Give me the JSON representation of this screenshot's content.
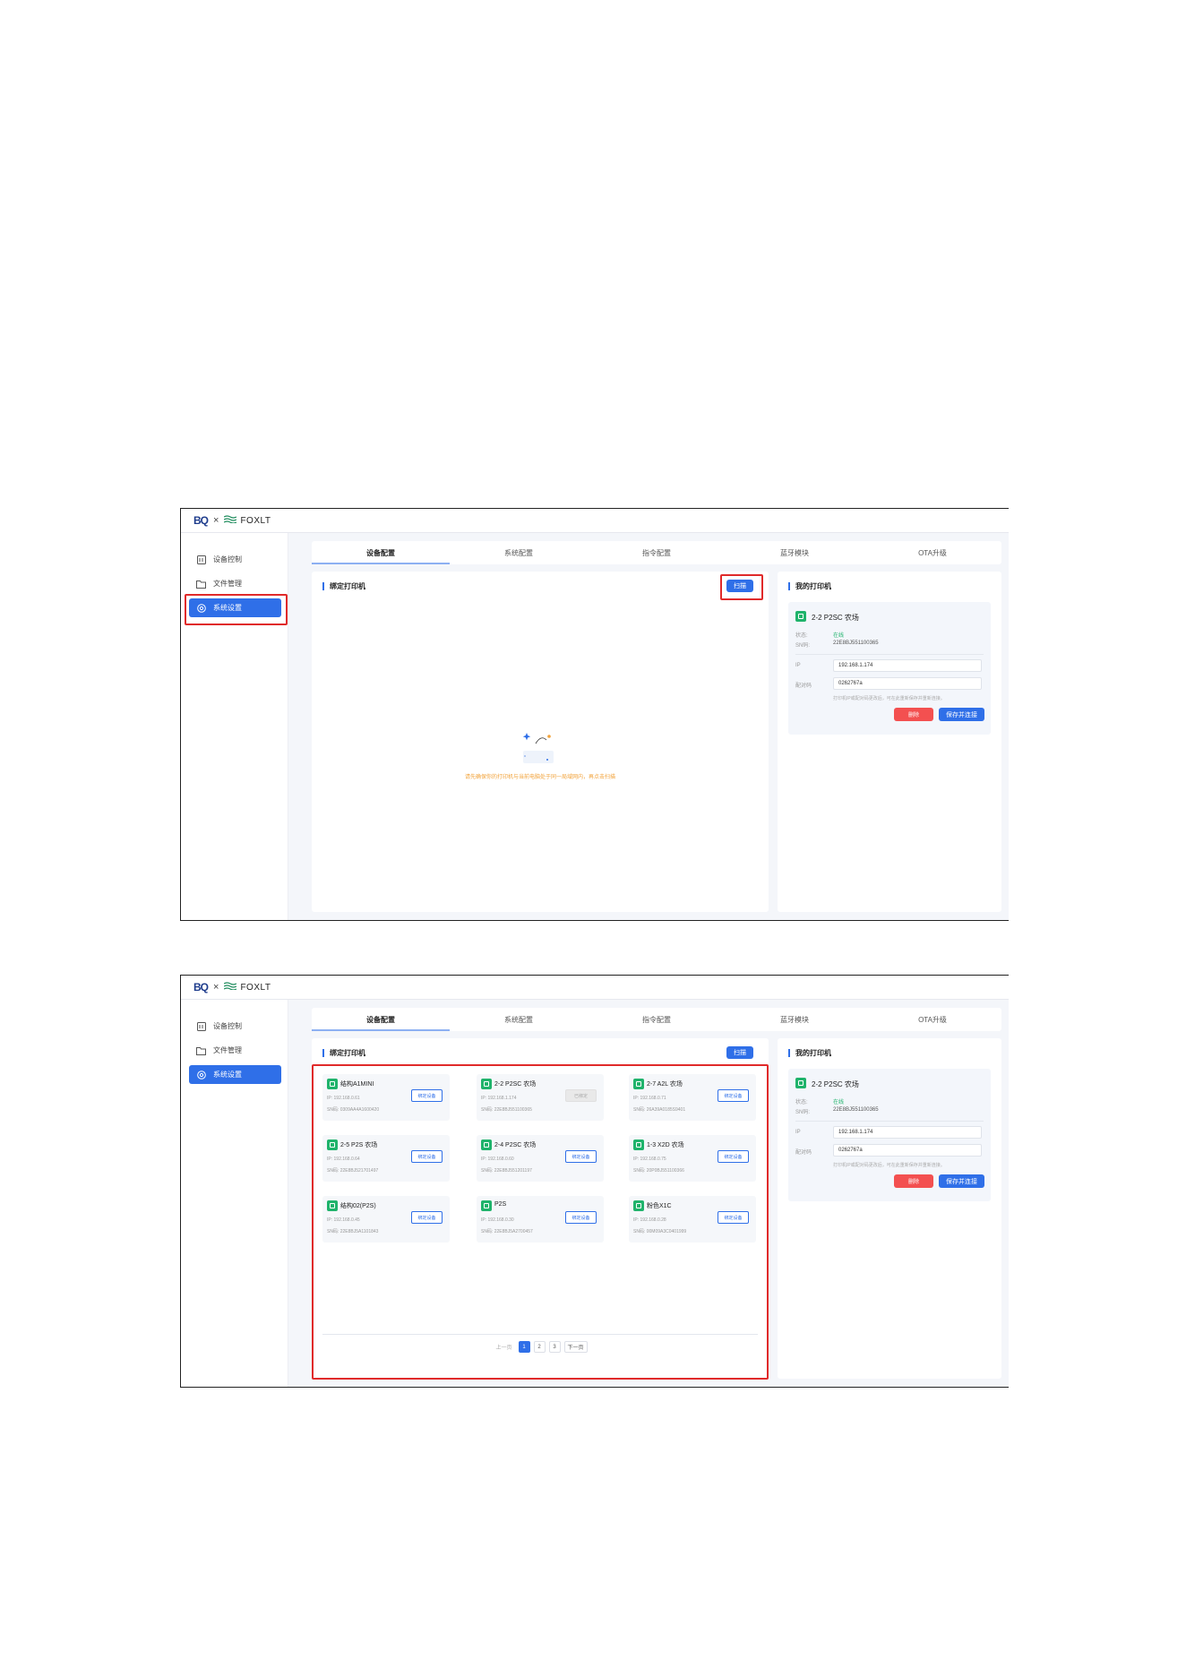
{
  "brand": {
    "bq": "BQ",
    "x": "×",
    "fox": "FOXLT"
  },
  "sidebar": {
    "items": [
      {
        "label": "设备控制",
        "icon": "device-control-icon"
      },
      {
        "label": "文件管理",
        "icon": "folder-icon"
      },
      {
        "label": "系统设置",
        "icon": "settings-icon"
      }
    ]
  },
  "tabs": [
    "设备配置",
    "系统配置",
    "指令配置",
    "蓝牙模块",
    "OTA升级"
  ],
  "bind_panel": {
    "title": "绑定打印机",
    "scan_label": "扫描",
    "empty_text": "请先确保你的打印机与当前电脑处于同一局域网内，再点击扫描"
  },
  "my_printer": {
    "title": "我的打印机",
    "name": "2-2 P2SC 农场",
    "status_key": "状态:",
    "status_value": "在线",
    "sn_key": "SN码:",
    "sn_value": "22E8BJ551100365",
    "ip_key": "IP",
    "ip_value": "192.168.1.174",
    "code_key": "配对码",
    "code_value": "0262767a",
    "hint": "打印机IP或配对码更改后，可在此重新保存并重新连接。",
    "delete_label": "删除",
    "save_label": "保存并连接"
  },
  "devices": [
    {
      "name": "结构A1MINI",
      "ip": "IP: 192.168.0.61",
      "sn": "SN码: 0309AA4A1600420",
      "button": "绑定设备",
      "bound": false
    },
    {
      "name": "2-2 P2SC 农场",
      "ip": "IP: 192.168.1.174",
      "sn": "SN码: 22E8BJ551100365",
      "button": "已绑定",
      "bound": true
    },
    {
      "name": "2-7 A2L 农场",
      "ip": "IP: 192.168.0.71",
      "sn": "SN码: 26A39A0185S9401",
      "button": "绑定设备",
      "bound": false
    },
    {
      "name": "2-5 P2S 农场",
      "ip": "IP: 192.168.0.64",
      "sn": "SN码: 22E8BJ521701497",
      "button": "绑定设备",
      "bound": false
    },
    {
      "name": "2-4 P2SC 农场",
      "ip": "IP: 192.168.0.60",
      "sn": "SN码: 22E8BJ551201197",
      "button": "绑定设备",
      "bound": false
    },
    {
      "name": "1-3 X2D 农场",
      "ip": "IP: 192.168.0.75",
      "sn": "SN码: 20P0BJ551100366",
      "button": "绑定设备",
      "bound": false
    },
    {
      "name": "结构02(P2S)",
      "ip": "IP: 192.168.0.45",
      "sn": "SN码: 22E8BJ5A1101843",
      "button": "绑定设备",
      "bound": false
    },
    {
      "name": "P2S",
      "ip": "IP: 192.168.0.30",
      "sn": "SN码: 22E8BJ5A2700457",
      "button": "绑定设备",
      "bound": false
    },
    {
      "name": "粉色X1C",
      "ip": "IP: 192.168.0.28",
      "sn": "SN码: 00M09A3C0401999",
      "button": "绑定设备",
      "bound": false
    }
  ],
  "pager": {
    "prev": "上一页",
    "pages": [
      "1",
      "2",
      "3"
    ],
    "next": "下一页"
  },
  "colors": {
    "accent": "#2f6fe8",
    "danger": "#f35050",
    "online": "#1fb36b",
    "highlight": "#e02a2a",
    "hint": "#f2a33b"
  }
}
